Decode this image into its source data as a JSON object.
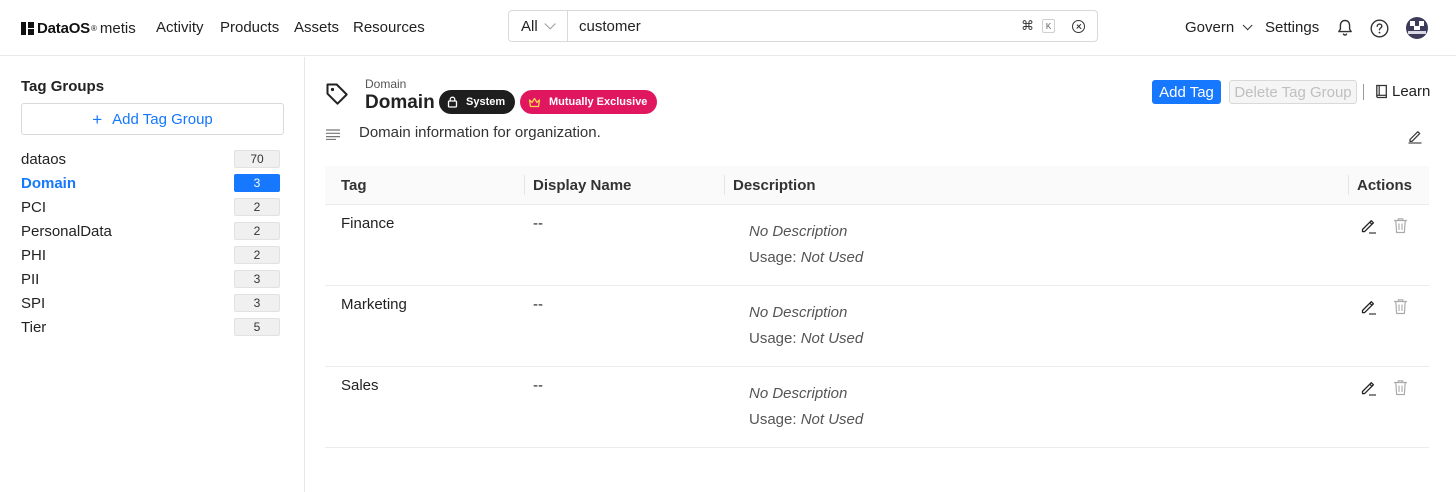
{
  "app": {
    "brand": "DataOS",
    "brand_reg": "®",
    "product": "metis"
  },
  "nav": {
    "items": [
      "Activity",
      "Products",
      "Assets",
      "Resources"
    ],
    "govern_label": "Govern",
    "settings_label": "Settings"
  },
  "search": {
    "type_label": "All",
    "query": "customer",
    "shortcut_cmd": "⌘",
    "shortcut_key": "K"
  },
  "sidebar": {
    "title": "Tag Groups",
    "add_label": "Add Tag Group",
    "groups": [
      {
        "name": "dataos",
        "count": "70",
        "active": false
      },
      {
        "name": "Domain",
        "count": "3",
        "active": true
      },
      {
        "name": "PCI",
        "count": "2",
        "active": false
      },
      {
        "name": "PersonalData",
        "count": "2",
        "active": false
      },
      {
        "name": "PHI",
        "count": "2",
        "active": false
      },
      {
        "name": "PII",
        "count": "3",
        "active": false
      },
      {
        "name": "SPI",
        "count": "3",
        "active": false
      },
      {
        "name": "Tier",
        "count": "5",
        "active": false
      }
    ]
  },
  "header": {
    "breadcrumb": "Domain",
    "title": "Domain",
    "badge_system": "System",
    "badge_mutex": "Mutually Exclusive",
    "add_tag_label": "Add Tag",
    "delete_group_label": "Delete Tag Group",
    "learn_label": "Learn",
    "description": "Domain information for organization."
  },
  "table": {
    "columns": [
      "Tag",
      "Display Name",
      "Description",
      "Actions"
    ],
    "usage_prefix": "Usage:",
    "rows": [
      {
        "tag": "Finance",
        "display_name": "--",
        "description": "No Description",
        "usage": "Not Used"
      },
      {
        "tag": "Marketing",
        "display_name": "--",
        "description": "No Description",
        "usage": "Not Used"
      },
      {
        "tag": "Sales",
        "display_name": "--",
        "description": "No Description",
        "usage": "Not Used"
      }
    ]
  },
  "icons": {
    "logo": "dataos-logo-icon",
    "search_clear": "close-circle-icon",
    "notifications": "bell-icon",
    "help": "question-circle-icon",
    "tag": "tag-icon",
    "description": "align-left-icon",
    "edit": "pencil-icon",
    "delete": "trash-icon",
    "learn": "book-icon"
  },
  "colors": {
    "accent": "#1677ff",
    "system_badge": "#1e1e1e",
    "mutex_badge": "#e0175e"
  }
}
